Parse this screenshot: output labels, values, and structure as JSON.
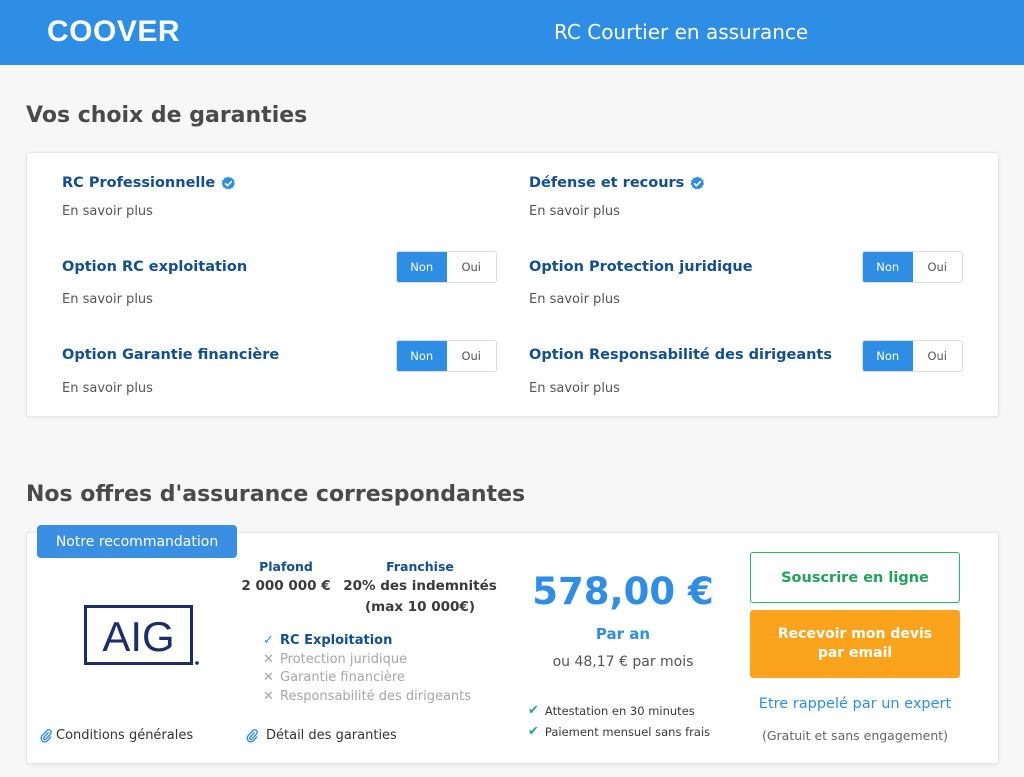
{
  "header": {
    "logo": "COOVER",
    "title": "RC Courtier en assurance"
  },
  "garanties": {
    "section_title": "Vos choix de garanties",
    "learn_more": "En savoir plus",
    "items": [
      {
        "label": "RC Professionnelle",
        "included": true
      },
      {
        "label": "Défense et recours",
        "included": true
      },
      {
        "label": "Option RC exploitation",
        "toggle": {
          "non": "Non",
          "oui": "Oui",
          "selected": "Non"
        }
      },
      {
        "label": "Option Protection juridique",
        "toggle": {
          "non": "Non",
          "oui": "Oui",
          "selected": "Non"
        }
      },
      {
        "label": "Option Garantie financière",
        "toggle": {
          "non": "Non",
          "oui": "Oui",
          "selected": "Non"
        }
      },
      {
        "label": "Option Responsabilité des dirigeants",
        "toggle": {
          "non": "Non",
          "oui": "Oui",
          "selected": "Non"
        }
      }
    ]
  },
  "offers": {
    "section_title": "Nos offres d'assurance correspondantes",
    "offer": {
      "badge": "Notre recommandation",
      "insurer_logo_text": "AIG",
      "plafond_label": "Plafond",
      "plafond_value": "2 000 000 €",
      "franchise_label": "Franchise",
      "franchise_value_line1": "20% des indemnités",
      "franchise_value_line2": "(max 10 000€)",
      "coverages": [
        {
          "label": "RC Exploitation",
          "included": true
        },
        {
          "label": "Protection juridique",
          "included": false
        },
        {
          "label": "Garantie financière",
          "included": false
        },
        {
          "label": "Responsabilité des dirigeants",
          "included": false
        }
      ],
      "price": "578,00 €",
      "price_period": "Par an",
      "price_monthly": "ou 48,17 € par mois",
      "features": [
        "Attestation en 30 minutes",
        "Paiement mensuel sans frais"
      ],
      "subscribe_button": "Souscrire en ligne",
      "quote_button_line1": "Recevoir mon devis",
      "quote_button_line2": "par email",
      "callback_link": "Etre rappelé par un expert",
      "callback_note": "(Gratuit et sans engagement)",
      "conditions_link": "Conditions générales",
      "details_link": "Détail des garanties"
    }
  },
  "colors": {
    "header_bg": "#2e8ee6",
    "label_blue": "#114e92",
    "accent_blue": "#2e8ee6",
    "green": "#27b86c",
    "orange": "#fba31c",
    "aig_navy": "#1c2d6e"
  }
}
